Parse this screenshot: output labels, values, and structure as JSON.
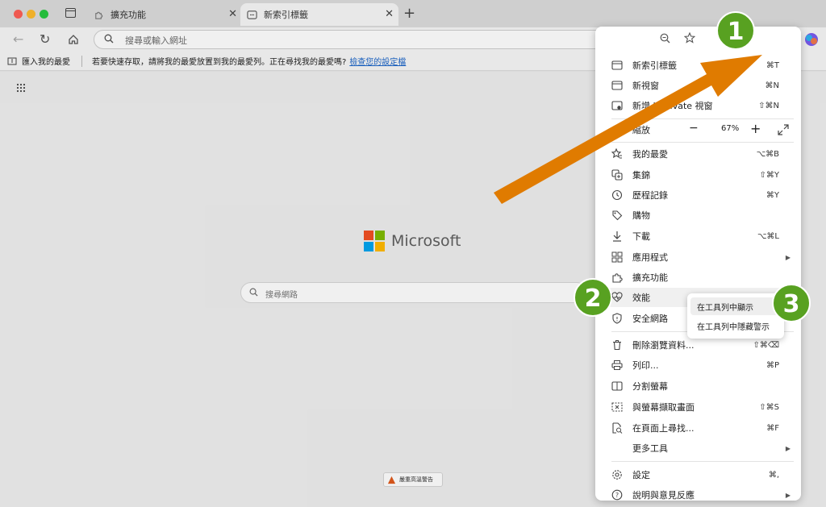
{
  "tabs": [
    {
      "label": "擴充功能"
    },
    {
      "label": "新索引標籤"
    }
  ],
  "address_bar": {
    "placeholder": "搜尋或輸入網址"
  },
  "favorites_bar": {
    "import_label": "匯入我的最愛",
    "message": "若要快速存取，請將我的最愛放置到我的最愛列。正在尋找我的最愛嗎?",
    "link": "檢查您的設定檔"
  },
  "new_tab": {
    "logo_text": "Microsoft",
    "search_placeholder": "搜尋網路",
    "alert_label": "嚴重高溫警告"
  },
  "more_button": "···",
  "menu": {
    "items": [
      {
        "label": "新索引標籤",
        "shortcut": "⌘T"
      },
      {
        "label": "新視窗",
        "shortcut": "⌘N"
      },
      {
        "label": "新增 InPrivate 視窗",
        "shortcut": "⇧⌘N"
      },
      {
        "label": "縮放",
        "zoom_value": "67%"
      },
      {
        "label": "我的最愛",
        "shortcut": "⌥⌘B"
      },
      {
        "label": "集錦",
        "shortcut": "⇧⌘Y"
      },
      {
        "label": "歷程記錄",
        "shortcut": "⌘Y"
      },
      {
        "label": "購物",
        "shortcut": ""
      },
      {
        "label": "下載",
        "shortcut": "⌥⌘L"
      },
      {
        "label": "應用程式",
        "shortcut": ""
      },
      {
        "label": "擴充功能",
        "shortcut": ""
      },
      {
        "label": "效能",
        "shortcut": ""
      },
      {
        "label": "安全網路",
        "shortcut": ""
      },
      {
        "label": "刪除瀏覽資料...",
        "shortcut": "⇧⌘⌫"
      },
      {
        "label": "列印...",
        "shortcut": "⌘P"
      },
      {
        "label": "分割螢幕",
        "shortcut": ""
      },
      {
        "label": "與螢幕擷取畫面",
        "shortcut": "⇧⌘S"
      },
      {
        "label": "在頁面上尋找...",
        "shortcut": "⌘F"
      },
      {
        "label": "更多工具",
        "shortcut": ""
      },
      {
        "label": "設定",
        "shortcut": "⌘,"
      },
      {
        "label": "說明與意見反應",
        "shortcut": ""
      }
    ]
  },
  "submenu": {
    "items": [
      {
        "label": "在工具列中顯示"
      },
      {
        "label": "在工具列中隱藏警示"
      }
    ]
  },
  "annotations": [
    {
      "label": "1"
    },
    {
      "label": "2"
    },
    {
      "label": "3"
    }
  ],
  "colors": {
    "badge": "#58a121",
    "arrow": "#e07b00"
  }
}
